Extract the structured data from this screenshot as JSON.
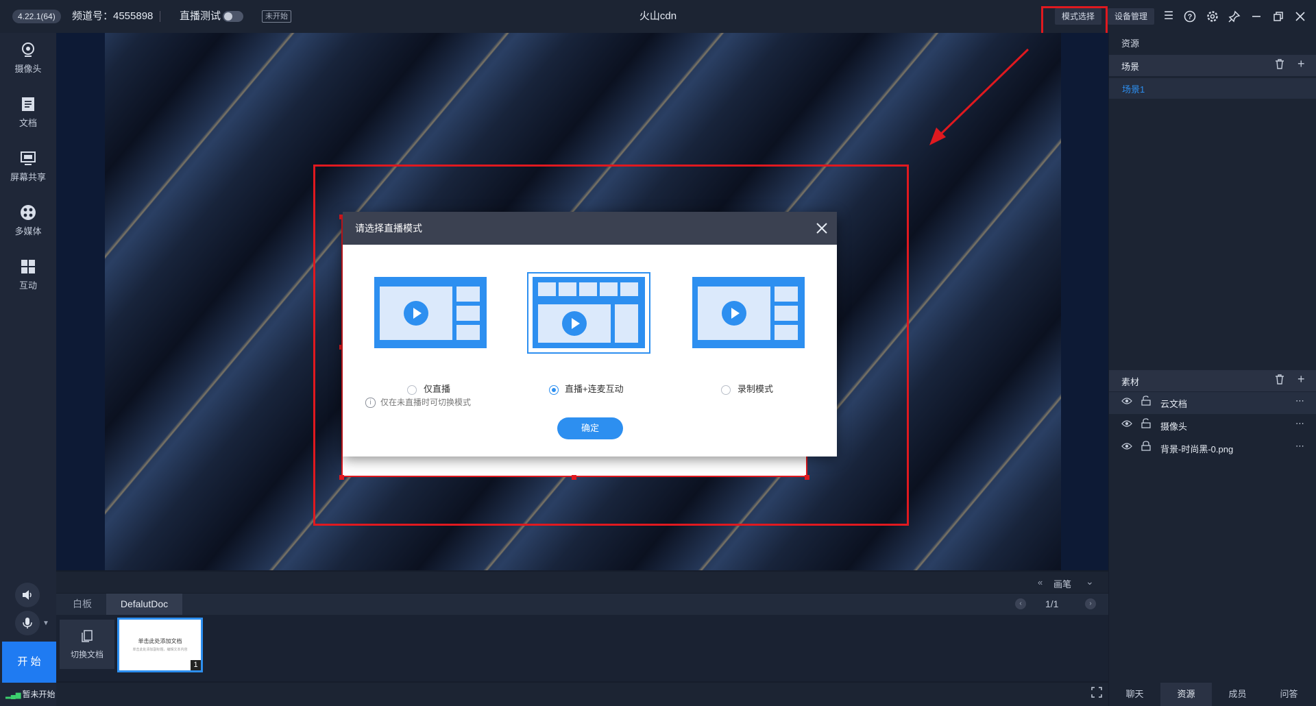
{
  "topbar": {
    "version": "4.22.1(64)",
    "channel": "频道号：4555898",
    "test_label": "直播测试",
    "status_badge": "未开始",
    "app_title": "火山cdn",
    "mode_button": "模式选择",
    "device_button": "设备管理",
    "icons": [
      "list-icon",
      "help-icon",
      "settings-icon",
      "pin-icon",
      "minimize-icon",
      "maximize-icon",
      "close-icon"
    ]
  },
  "sidebar": {
    "items": [
      {
        "label": "摄像头",
        "icon": "camera-icon"
      },
      {
        "label": "文档",
        "icon": "document-icon"
      },
      {
        "label": "屏幕共享",
        "icon": "screen-share-icon"
      },
      {
        "label": "多媒体",
        "icon": "multimedia-icon"
      },
      {
        "label": "互动",
        "icon": "interact-icon"
      }
    ],
    "start_button": "开 始",
    "live_status": "暂未开始"
  },
  "modal": {
    "title": "请选择直播模式",
    "options": [
      {
        "label": "仅直播",
        "selected": false
      },
      {
        "label": "直播+连麦互动",
        "selected": true
      },
      {
        "label": "录制模式",
        "selected": false
      }
    ],
    "hint": "仅在未直播时可切换模式",
    "confirm": "确定"
  },
  "docbar": {
    "pen_label": "画笔",
    "tabs": [
      {
        "label": "白板",
        "active": false
      },
      {
        "label": "DefalutDoc",
        "active": true
      }
    ],
    "page": "1/1",
    "switch_doc": "切换文档",
    "thumb_title": "单击此处添加文档",
    "thumb_sub": "单击此处添加副标题，编辑文本内容",
    "thumb_index": "1"
  },
  "resources": {
    "header": "资源",
    "scene_title": "场景",
    "scenes": [
      "场景1"
    ],
    "materials_title": "素材",
    "materials": [
      {
        "name": "云文档",
        "locked": false
      },
      {
        "name": "摄像头",
        "locked": false
      },
      {
        "name": "背景-时尚黑-0.png",
        "locked": true
      }
    ]
  },
  "right_tabs": [
    {
      "label": "聊天",
      "active": false
    },
    {
      "label": "资源",
      "active": true
    },
    {
      "label": "成员",
      "active": false
    },
    {
      "label": "问答",
      "active": false
    }
  ],
  "colors": {
    "accent": "#2d8ff0",
    "highlight": "#e0191f",
    "start": "#1f7bf2",
    "dark_bg": "#161d2b"
  }
}
